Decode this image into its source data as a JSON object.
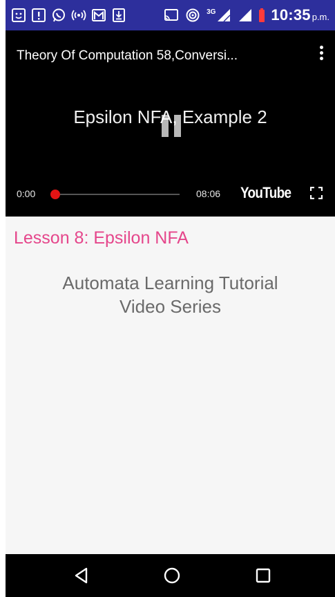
{
  "status_bar": {
    "background": "#2d2f9c",
    "left_icons": [
      "face-notification-icon",
      "alert-notification-icon",
      "whatsapp-icon",
      "hotspot-icon",
      "gmail-icon",
      "download-icon"
    ],
    "right_icons": [
      "cast-icon",
      "wifi-hotspot-icon",
      "signal-3g-icon",
      "signal-icon",
      "battery-low-icon"
    ],
    "network_label": "3G",
    "time": "10:35",
    "ampm": "p.m."
  },
  "player": {
    "title": "Theory Of Computation 58,Conversi...",
    "frame_caption": "Epsilon NFA, Example 2",
    "current_time": "0:00",
    "duration": "08:06",
    "progress_fraction": 0.0,
    "brand": "YouTube",
    "accent_color": "#e31414"
  },
  "content": {
    "lesson_title": "Lesson 8: Epsilon NFA",
    "lesson_color": "#e5468b",
    "subtitle_line1": "Automata Learning Tutorial",
    "subtitle_line2": "Video Series"
  },
  "nav_bar": {
    "buttons": [
      "back-icon",
      "home-icon",
      "recents-icon"
    ]
  }
}
